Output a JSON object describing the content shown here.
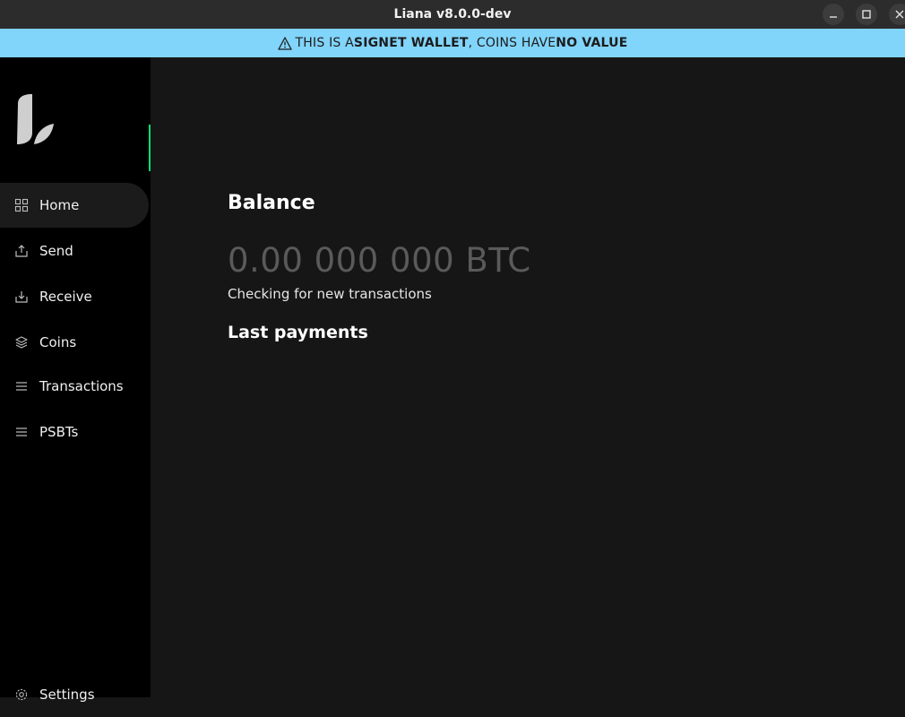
{
  "window": {
    "title": "Liana v8.0.0-dev"
  },
  "banner": {
    "part1": "THIS IS A ",
    "part2": "SIGNET WALLET",
    "part3": ", COINS HAVE ",
    "part4": "NO VALUE",
    "color": "#81d4fa"
  },
  "sidebar": {
    "items": [
      {
        "label": "Home",
        "icon": "grid-icon",
        "active": true
      },
      {
        "label": "Send",
        "icon": "send-icon"
      },
      {
        "label": "Receive",
        "icon": "receive-icon"
      },
      {
        "label": "Coins",
        "icon": "layers-icon"
      },
      {
        "label": "Transactions",
        "icon": "list-icon"
      },
      {
        "label": "PSBTs",
        "icon": "list-icon"
      }
    ],
    "settings": "Settings",
    "accent": "#00e074"
  },
  "main": {
    "balance_title": "Balance",
    "balance_amount": "0.00 000 000 BTC",
    "status": "Checking for new transactions",
    "last_payments_title": "Last payments"
  }
}
